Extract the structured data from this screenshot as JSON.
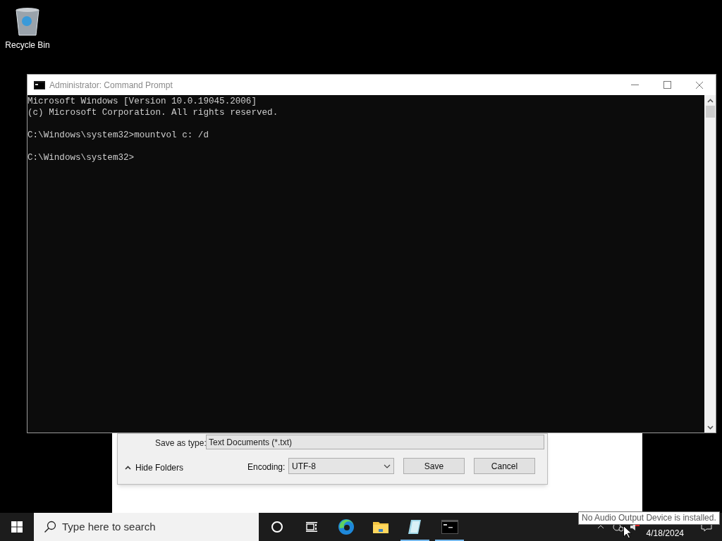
{
  "desktop_icons": [
    {
      "label": "Recycle Bin"
    }
  ],
  "save_dialog": {
    "save_as_type_label": "Save as type:",
    "save_as_type_value": "Text Documents (*.txt)",
    "hide_folders": "Hide Folders",
    "encoding_label": "Encoding:",
    "encoding_value": "UTF-8",
    "buttons": [
      "Save",
      "Cancel"
    ]
  },
  "console_window": {
    "title": "Administrator: Command Prompt",
    "paragraphs": [
      [
        "Microsoft Windows [Version 10.0.19045.2006]",
        "(c) Microsoft Corporation. All rights reserved."
      ],
      [
        "C:\\Windows\\system32>mountvol c: /d"
      ],
      [
        "C:\\Windows\\system32>"
      ]
    ]
  },
  "taskbar": {
    "search_placeholder": "Type here to search",
    "apps": [
      {
        "kind": "cortana",
        "running": false
      },
      {
        "kind": "taskview",
        "running": false
      },
      {
        "kind": "edge",
        "running": false
      },
      {
        "kind": "explorer",
        "running": false
      },
      {
        "kind": "notepad",
        "running": true
      },
      {
        "kind": "console",
        "running": true
      }
    ],
    "date": "4/18/2024"
  },
  "tooltip": "No Audio Output Device is installed."
}
